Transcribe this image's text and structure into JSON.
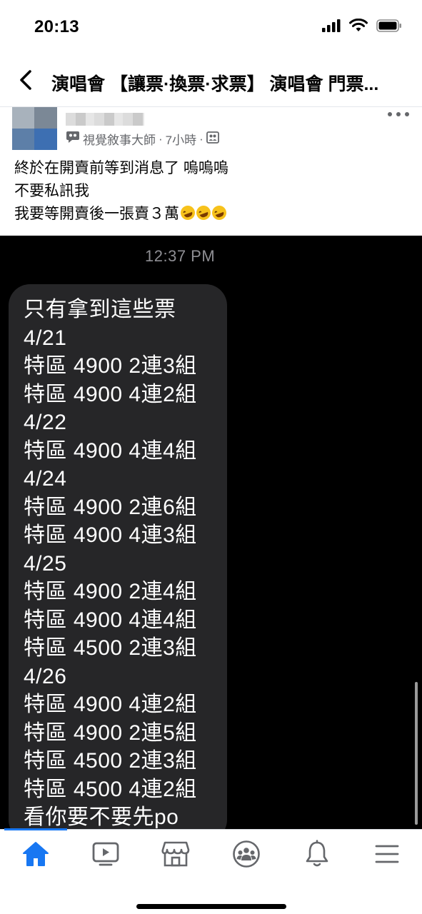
{
  "status_bar": {
    "time": "20:13"
  },
  "header": {
    "title": "演唱會 【讓票·換票·求票】 演唱會 門票..."
  },
  "post": {
    "meta": {
      "author_label": "視覺敘事大師",
      "separator": "·",
      "time_ago": "7小時",
      "audience_icon": "group-icon"
    },
    "lines": [
      "終於在開賣前等到消息了 嗚嗚嗚",
      "不要私訊我",
      "我要等開賣後一張賣３萬"
    ],
    "emoji_count": 3,
    "emoji_name": "rolling-on-floor-laughing"
  },
  "screenshot": {
    "time": "12:37 PM",
    "message_lines": [
      "只有拿到這些票",
      "4/21",
      "特區 4900 2連3組",
      "特區 4900 4連2組",
      "4/22",
      "特區 4900 4連4組",
      "4/24",
      "特區 4900 2連6組",
      "特區 4900 4連3組",
      "4/25",
      "特區 4900 2連4組",
      "特區 4900 4連4組",
      "特區 4500 2連3組",
      "4/26",
      "特區 4900 4連2組",
      "特區 4900 2連5組",
      "特區 4500 2連3組",
      "特區 4500 4連2組",
      "看你要不要先po"
    ]
  },
  "bottom_nav": {
    "items": [
      {
        "name": "home",
        "icon": "home-icon",
        "active": true
      },
      {
        "name": "watch",
        "icon": "video-icon",
        "active": false
      },
      {
        "name": "marketplace",
        "icon": "store-icon",
        "active": false
      },
      {
        "name": "groups",
        "icon": "groups-icon",
        "active": false
      },
      {
        "name": "notifications",
        "icon": "bell-icon",
        "active": false
      },
      {
        "name": "menu",
        "icon": "hamburger-icon",
        "active": false
      }
    ]
  },
  "colors": {
    "accent": "#1877f2",
    "icon_gray": "#65676b",
    "bubble": "#262628",
    "image_bg": "#000000"
  }
}
